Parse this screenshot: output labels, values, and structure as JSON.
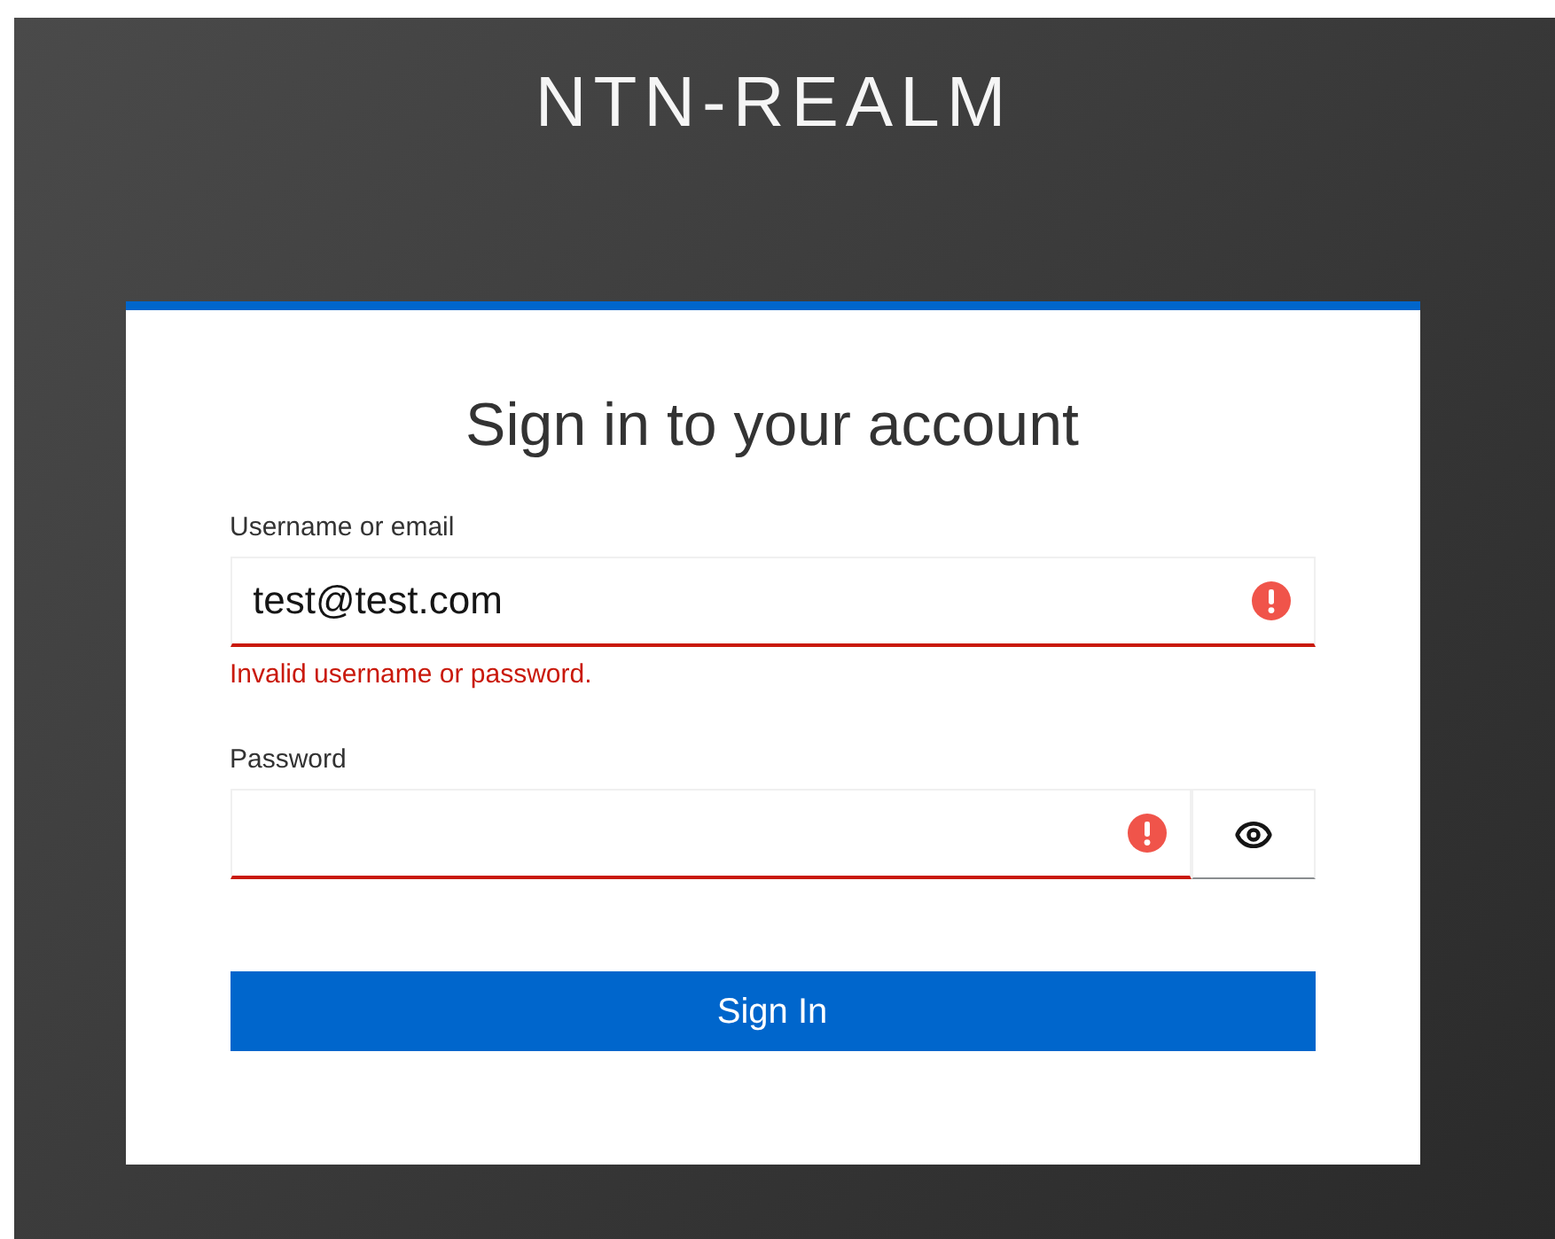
{
  "realm": {
    "title": "NTN-REALM"
  },
  "card": {
    "heading": "Sign in to your account"
  },
  "fields": [
    {
      "kind": "text",
      "label": "Username or email",
      "value": "test@test.com",
      "invalid": true,
      "error": "Invalid username or password."
    },
    {
      "kind": "password",
      "label": "Password",
      "invalid": true
    }
  ],
  "submit": {
    "label": "Sign In"
  }
}
